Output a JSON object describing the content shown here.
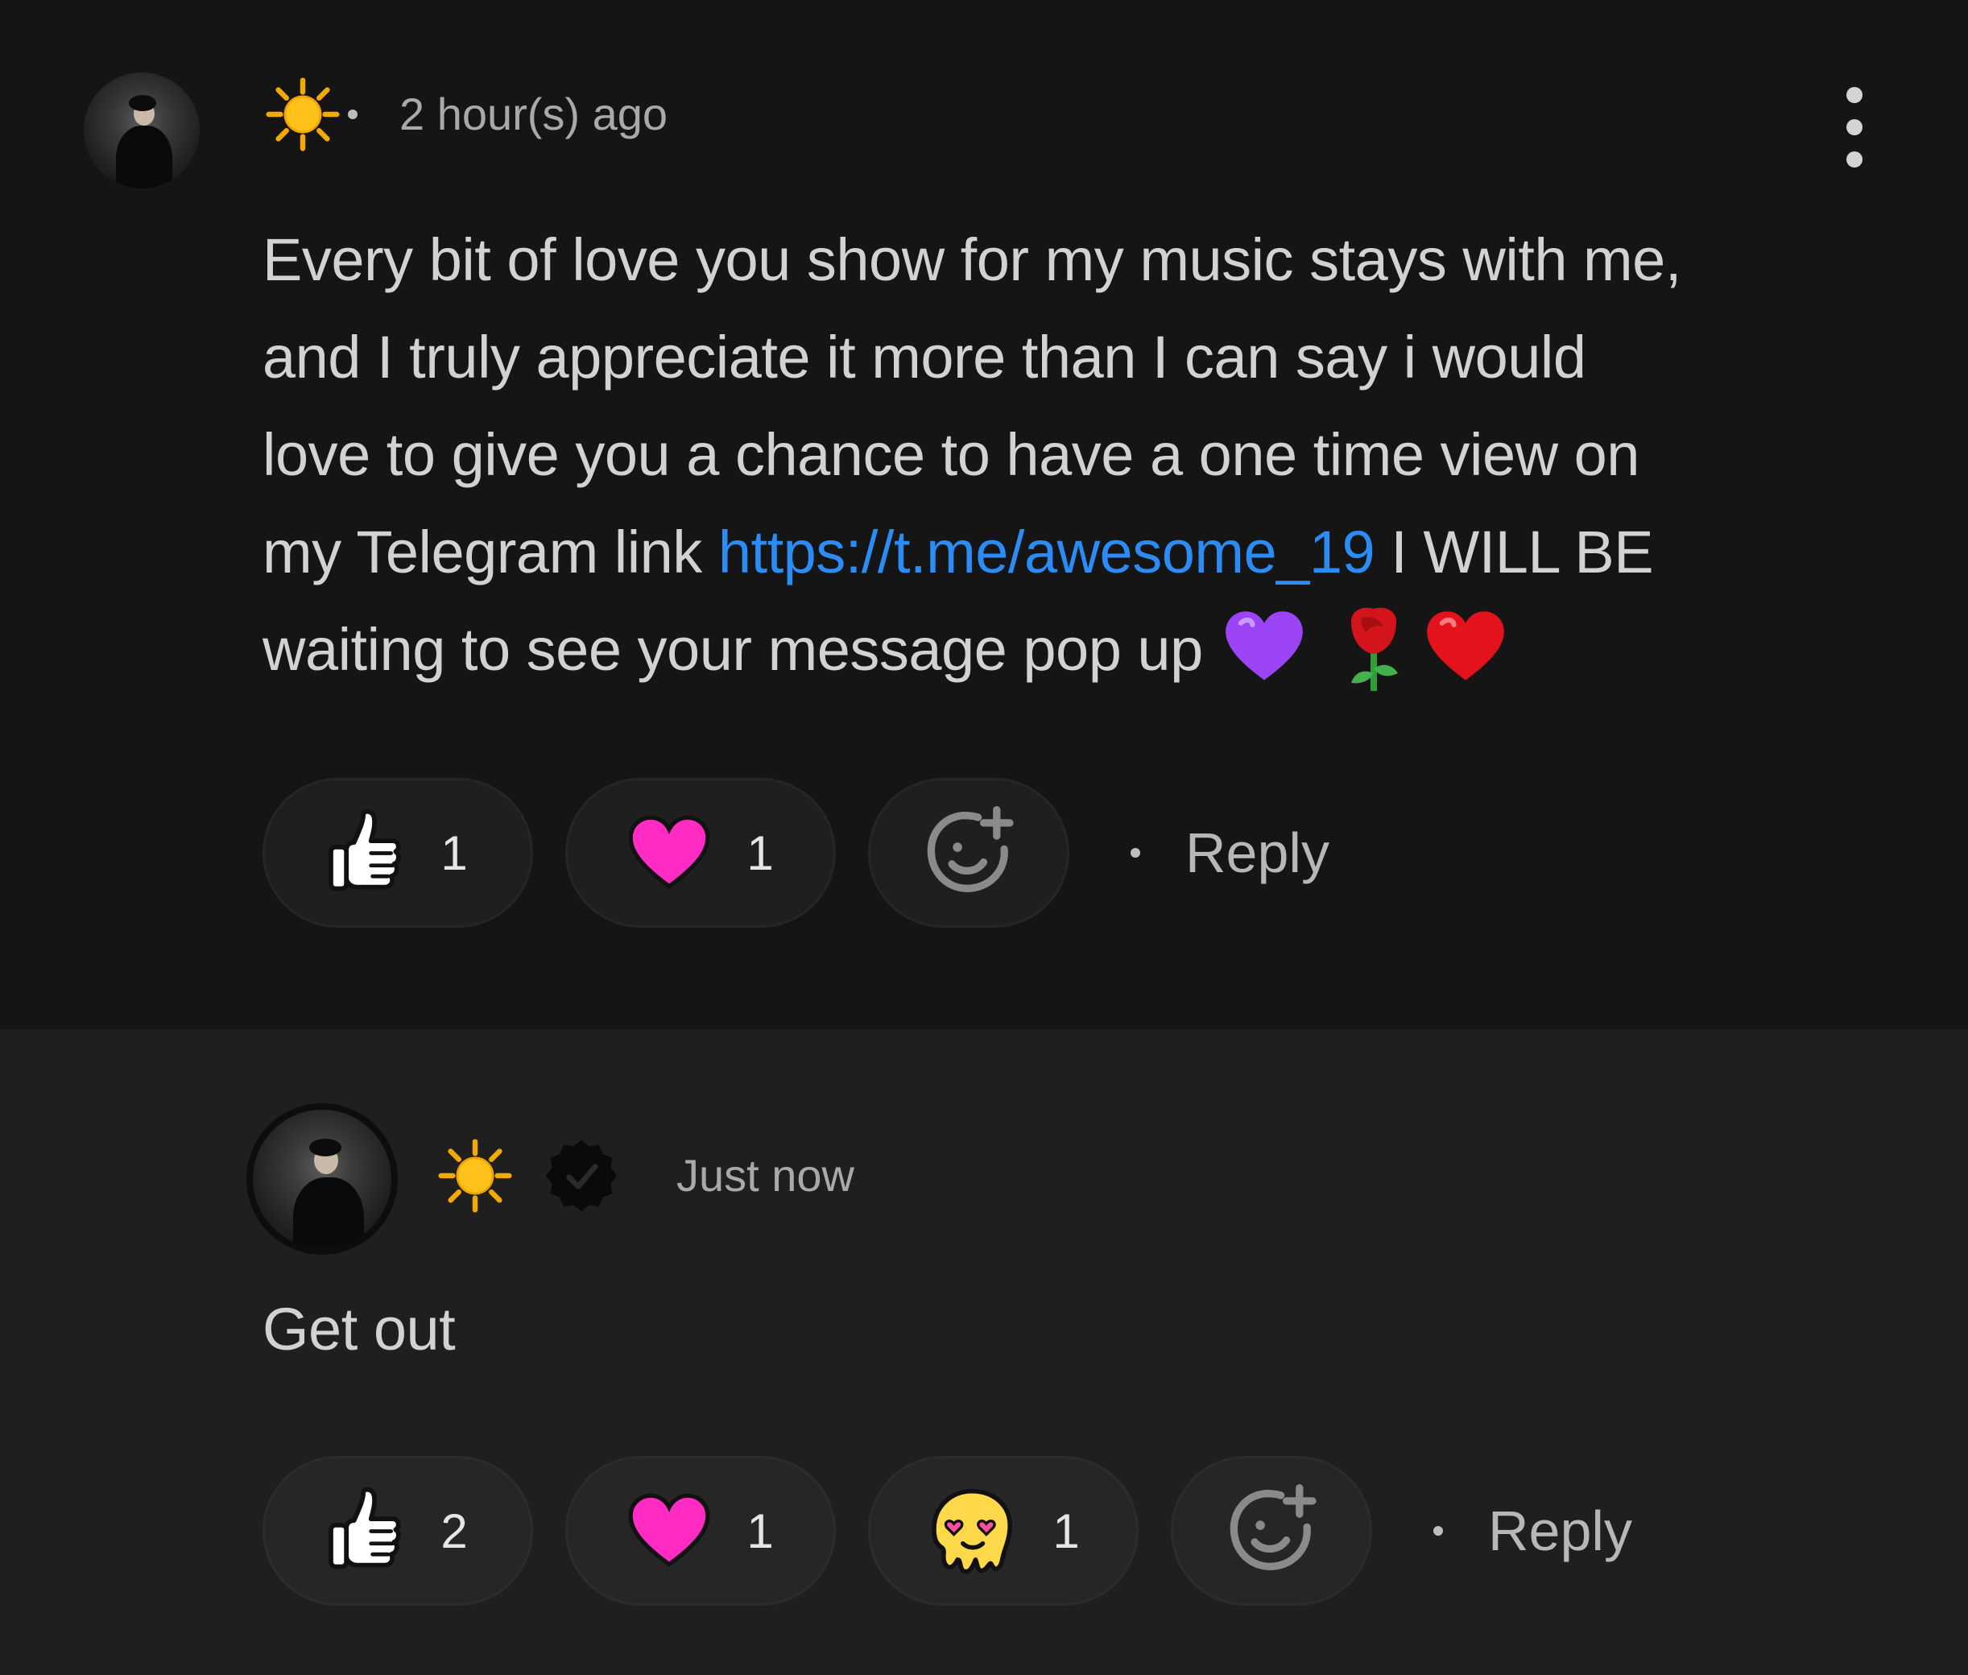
{
  "comments": [
    {
      "time": "2 hour(s) ago",
      "text_lines": [
        "Every bit of love you show for my music stays with me,",
        "and I truly appreciate it more than I can say i would",
        "love to give you a chance to have a one time view on"
      ],
      "line4_before": "my Telegram link ",
      "link": "https://t.me/awesome_19",
      "line4_after": " I WILL BE",
      "line5": "waiting to see your message pop up ",
      "emojis": [
        "purple-heart",
        "rose",
        "red-heart"
      ],
      "reactions": [
        {
          "icon": "thumbs-up",
          "count": "1"
        },
        {
          "icon": "pink-heart",
          "count": "1"
        }
      ],
      "reply_label": "Reply"
    },
    {
      "time": "Just now",
      "text": "Get out",
      "reactions": [
        {
          "icon": "thumbs-up",
          "count": "2"
        },
        {
          "icon": "pink-heart",
          "count": "1"
        },
        {
          "icon": "heart-eyes-melting-face",
          "count": "1"
        }
      ],
      "reply_label": "Reply"
    }
  ],
  "colors": {
    "background": "#151515",
    "reply_background": "#1f1f1f",
    "link": "#2a8cf4",
    "heart": "#ff2bc2"
  }
}
